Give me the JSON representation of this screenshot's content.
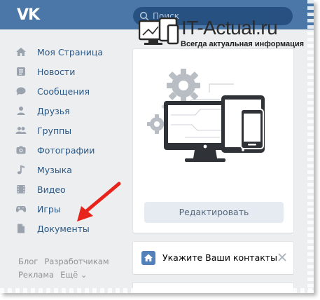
{
  "header": {
    "logo": "VK",
    "search_placeholder": "Поиск"
  },
  "watermark": {
    "title": "IT-Actual.ru",
    "subtitle": "Всегда актуальная информация"
  },
  "sidebar": {
    "items": [
      {
        "label": "Моя Страница",
        "icon": "home-icon"
      },
      {
        "label": "Новости",
        "icon": "news-icon"
      },
      {
        "label": "Сообщения",
        "icon": "messages-icon"
      },
      {
        "label": "Друзья",
        "icon": "friend-icon"
      },
      {
        "label": "Группы",
        "icon": "groups-icon"
      },
      {
        "label": "Фотографии",
        "icon": "camera-icon"
      },
      {
        "label": "Музыка",
        "icon": "music-note-icon"
      },
      {
        "label": "Видео",
        "icon": "film-icon"
      },
      {
        "label": "Игры",
        "icon": "gamepad-icon"
      },
      {
        "label": "Документы",
        "icon": "document-icon"
      }
    ],
    "footer_row1": [
      "Блог",
      "Разработчикам"
    ],
    "footer_row2": [
      "Реклама",
      "Ещё ⌄"
    ]
  },
  "main": {
    "edit_button": "Редактировать",
    "contact_prompt": "Укажите Ваши контакты"
  },
  "colors": {
    "header": "#4a76a8",
    "link": "#2a5885",
    "icon": "#99a2ad",
    "arrow": "#e8231c"
  }
}
